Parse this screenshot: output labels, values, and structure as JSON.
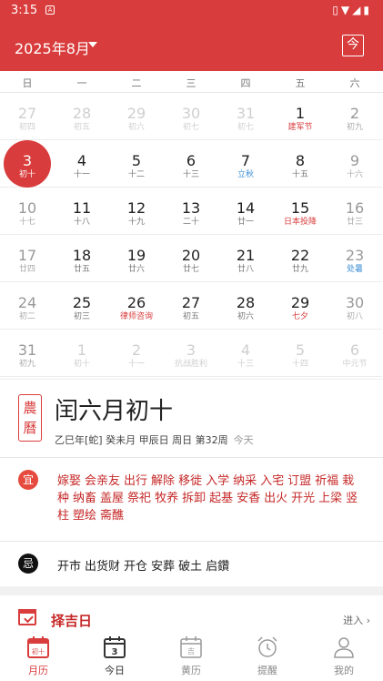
{
  "status_bar": {
    "time": "3:15",
    "notif_label": "A"
  },
  "header": {
    "month_title": "2025年8月",
    "today_button": "今"
  },
  "weekdays": [
    "日",
    "一",
    "二",
    "三",
    "四",
    "五",
    "六"
  ],
  "calendar": {
    "weeks": [
      [
        {
          "day": "27",
          "sub": "初四",
          "other": true
        },
        {
          "day": "28",
          "sub": "初五",
          "other": true
        },
        {
          "day": "29",
          "sub": "初六",
          "other": true
        },
        {
          "day": "30",
          "sub": "初七",
          "other": true
        },
        {
          "day": "31",
          "sub": "初七",
          "other": true
        },
        {
          "day": "1",
          "sub": "建军节",
          "festival": "red"
        },
        {
          "day": "2",
          "sub": "初九",
          "weekend": true
        }
      ],
      [
        {
          "day": "3",
          "sub": "初十",
          "selected": true
        },
        {
          "day": "4",
          "sub": "十一"
        },
        {
          "day": "5",
          "sub": "十二"
        },
        {
          "day": "6",
          "sub": "十三"
        },
        {
          "day": "7",
          "sub": "立秋",
          "festival": "blue"
        },
        {
          "day": "8",
          "sub": "十五"
        },
        {
          "day": "9",
          "sub": "十六",
          "weekend": true
        }
      ],
      [
        {
          "day": "10",
          "sub": "十七",
          "weekend": true
        },
        {
          "day": "11",
          "sub": "十八"
        },
        {
          "day": "12",
          "sub": "十九"
        },
        {
          "day": "13",
          "sub": "二十"
        },
        {
          "day": "14",
          "sub": "廿一"
        },
        {
          "day": "15",
          "sub": "日本投降",
          "festival": "red"
        },
        {
          "day": "16",
          "sub": "廿三",
          "weekend": true
        }
      ],
      [
        {
          "day": "17",
          "sub": "廿四",
          "weekend": true
        },
        {
          "day": "18",
          "sub": "廿五"
        },
        {
          "day": "19",
          "sub": "廿六"
        },
        {
          "day": "20",
          "sub": "廿七"
        },
        {
          "day": "21",
          "sub": "廿八"
        },
        {
          "day": "22",
          "sub": "廿九"
        },
        {
          "day": "23",
          "sub": "处暑",
          "weekend": true,
          "festival": "blue"
        }
      ],
      [
        {
          "day": "24",
          "sub": "初二",
          "weekend": true
        },
        {
          "day": "25",
          "sub": "初三"
        },
        {
          "day": "26",
          "sub": "律师咨询",
          "festival": "red"
        },
        {
          "day": "27",
          "sub": "初五"
        },
        {
          "day": "28",
          "sub": "初六"
        },
        {
          "day": "29",
          "sub": "七夕",
          "festival": "red"
        },
        {
          "day": "30",
          "sub": "初八",
          "weekend": true
        }
      ],
      [
        {
          "day": "31",
          "sub": "初九",
          "weekend": true
        },
        {
          "day": "1",
          "sub": "初十",
          "other": true
        },
        {
          "day": "2",
          "sub": "十一",
          "other": true
        },
        {
          "day": "3",
          "sub": "抗战胜利",
          "other": true
        },
        {
          "day": "4",
          "sub": "十三",
          "other": true
        },
        {
          "day": "5",
          "sub": "十四",
          "other": true
        },
        {
          "day": "6",
          "sub": "中元节",
          "other": true
        }
      ]
    ]
  },
  "lunar": {
    "seal": "農曆",
    "title": "闰六月初十",
    "ganzhi": "乙巳年[蛇] 癸未月 甲辰日 周日 第32周",
    "today_label": "今天"
  },
  "yi": {
    "badge": "宜",
    "items": [
      "嫁娶",
      "会亲友",
      "出行",
      "解除",
      "移徙",
      "入学",
      "纳采",
      "入宅",
      "订盟",
      "祈福",
      "栽种",
      "纳畜",
      "盖屋",
      "祭祀",
      "牧养",
      "拆卸",
      "起基",
      "安香",
      "出火",
      "开光",
      "上梁",
      "竖柱",
      "塑绘",
      "斋醮"
    ]
  },
  "ji": {
    "badge": "忌",
    "items": [
      "开市",
      "出货财",
      "开仓",
      "安葬",
      "破土",
      "启鑽"
    ]
  },
  "zeji": {
    "title": "择吉日",
    "more": "进入 ›"
  },
  "tabbar": {
    "tabs": [
      {
        "label": "月历",
        "icon_text": "初十"
      },
      {
        "label": "今日",
        "icon_text": "3"
      },
      {
        "label": "黄历",
        "icon_text": "吉"
      },
      {
        "label": "提醒"
      },
      {
        "label": "我的"
      }
    ]
  },
  "colors": {
    "primary": "#d93c3c",
    "festival_blue": "#3b8fd6"
  }
}
